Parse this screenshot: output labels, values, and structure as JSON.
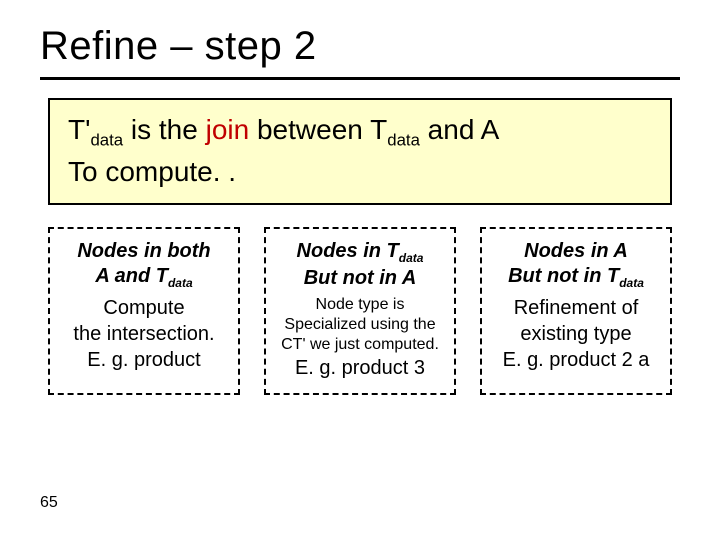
{
  "title": "Refine – step 2",
  "box": {
    "l1_a": "T'",
    "l1_sub1": "data",
    "l1_b": " is the ",
    "l1_join": "join",
    "l1_c": " between T",
    "l1_sub2": "data",
    "l1_d": " and A",
    "l2": "To compute. ."
  },
  "cols": {
    "c1": {
      "h1": "Nodes in both",
      "h2a": "A and T",
      "h2sub": "data",
      "b1": "Compute",
      "b2": "the intersection.",
      "b3": "E. g. product"
    },
    "c2": {
      "h1a": "Nodes in T",
      "h1sub": "data",
      "h2": "But not in A",
      "s1": "Node type is",
      "s2": "Specialized using the",
      "s3": "CT' we just computed.",
      "b3": "E. g. product 3"
    },
    "c3": {
      "h1": "Nodes in A",
      "h2a": "But not in T",
      "h2sub": "data",
      "b1": "Refinement of",
      "b2": "existing type",
      "b3": "E. g. product 2 a"
    }
  },
  "page": "65"
}
